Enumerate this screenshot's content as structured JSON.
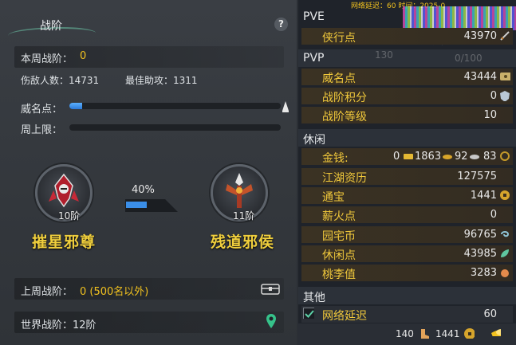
{
  "left_panel": {
    "title": "战阶",
    "help": "?",
    "weekly_rank_label": "本周战阶：",
    "weekly_rank_value": "0",
    "enemies_label": "伤敌人数：14731",
    "assists_label": "最佳助攻：1311",
    "prestige_label": "威名点：",
    "prestige_progress": 0.06,
    "weekly_cap_label": "周上限：",
    "weekly_cap_progress": 0.0,
    "current_rank": {
      "level": "10阶",
      "name": "摧星邪尊"
    },
    "next_rank": {
      "level": "11阶",
      "name": "残道邪侯"
    },
    "progress_percent_label": "40%",
    "progress_fraction": 0.4,
    "last_week_label": "上周战阶：",
    "last_week_value": "0 (500名以外)",
    "world_rank_label": "世界战阶：12阶"
  },
  "right_panel": {
    "top_ghost": "网络延迟：60    时间：2025-0",
    "pve": {
      "title": "PVE",
      "rows": [
        {
          "label": "侠行点",
          "value": "43970"
        }
      ],
      "ghost_text": "109.59万/21"
    },
    "pvp": {
      "title": "PVP",
      "ghost_a": "130",
      "ghost_b": "0/100",
      "rows": [
        {
          "label": "威名点",
          "value": "43444"
        },
        {
          "label": "战阶积分",
          "value": "0"
        },
        {
          "label": "战阶等级",
          "value": "10"
        }
      ]
    },
    "leisure": {
      "title": "休闲",
      "money": {
        "label": "金钱:",
        "gold": "0",
        "silver": "1863",
        "copper": "92",
        "coin": "83"
      },
      "rows": [
        {
          "label": "江湖资历",
          "value": "127575"
        },
        {
          "label": "通宝",
          "value": "1441"
        },
        {
          "label": "薪火点",
          "value": "0"
        },
        {
          "label": "园宅币",
          "value": "96765"
        },
        {
          "label": "休闲点",
          "value": "43985"
        },
        {
          "label": "桃李值",
          "value": "3283"
        }
      ]
    },
    "other": {
      "title": "其他",
      "net_label": "网络延迟",
      "net_value": "60",
      "net_checked": true
    },
    "bottom": {
      "a": "140",
      "b": "1441"
    }
  },
  "colors": {
    "accent_yellow": "#f2c21f",
    "bar_blue": "#2c79d8",
    "label_gold": "#f0c83b"
  }
}
